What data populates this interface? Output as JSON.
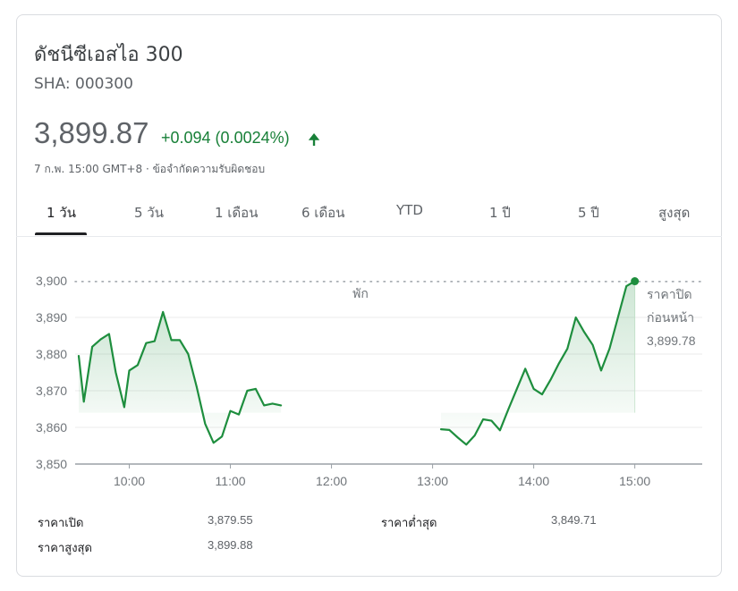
{
  "header": {
    "name": "ดัชนีซีเอสไอ 300",
    "ticker": "SHA: 000300",
    "price": "3,899.87",
    "change": "+0.094 (0.0024%)",
    "timestamp": "7 ก.พ. 15:00 GMT+8 · ข้อจำกัดความรับผิดชอบ"
  },
  "tabs": [
    "1 วัน",
    "5 วัน",
    "1 เดือน",
    "6 เดือน",
    "YTD",
    "1 ปี",
    "5 ปี",
    "สูงสุด"
  ],
  "active_tab": "1 วัน",
  "colors": {
    "line": "#1e8e3e",
    "positive": "#188038",
    "prev_close": "#1e8e3e"
  },
  "chart_data": {
    "type": "line",
    "y_ticks": [
      "3,900",
      "3,890",
      "3,880",
      "3,870",
      "3,860",
      "3,850"
    ],
    "y_tick_values": [
      3900,
      3890,
      3880,
      3870,
      3860,
      3850
    ],
    "x_ticks": [
      "10:00",
      "11:00",
      "12:00",
      "13:00",
      "14:00",
      "15:00"
    ],
    "x_tick_values": [
      "10:00",
      "11:00",
      "12:00",
      "13:00",
      "14:00",
      "15:00"
    ],
    "ylim": [
      3850,
      3900
    ],
    "xlim": [
      "09:30",
      "15:40"
    ],
    "break_label": "พัก",
    "prev_close_label": [
      "ราคาปิด",
      "ก่อนหน้า",
      "3,899.78"
    ],
    "prev_close": 3899.78,
    "morning": {
      "x": [
        "09:30",
        "09:33",
        "09:38",
        "09:43",
        "09:48",
        "09:52",
        "09:57",
        "10:00",
        "10:05",
        "10:10",
        "10:15",
        "10:20",
        "10:25",
        "10:30",
        "10:35",
        "10:40",
        "10:45",
        "10:50",
        "10:55",
        "11:00",
        "11:05",
        "11:10",
        "11:15",
        "11:20",
        "11:25",
        "11:30"
      ],
      "y": [
        3879.5,
        3867,
        3882,
        3884,
        3885.5,
        3875,
        3865.5,
        3875.5,
        3877,
        3883,
        3883.5,
        3891.5,
        3883.8,
        3883.8,
        3880,
        3871,
        3861,
        3855.8,
        3857.5,
        3864.5,
        3863.5,
        3870,
        3870.5,
        3866,
        3866.5,
        3866
      ]
    },
    "afternoon": {
      "x": [
        "13:05",
        "13:10",
        "13:15",
        "13:20",
        "13:25",
        "13:30",
        "13:35",
        "13:40",
        "13:45",
        "13:50",
        "13:55",
        "14:00",
        "14:05",
        "14:10",
        "14:15",
        "14:20",
        "14:25",
        "14:30",
        "14:35",
        "14:40",
        "14:45",
        "14:50",
        "14:55",
        "15:00"
      ],
      "y": [
        3859.5,
        3859.3,
        3857.2,
        3855.3,
        3857.8,
        3862.2,
        3861.8,
        3859.2,
        3865,
        3870.5,
        3876,
        3870.5,
        3869,
        3873,
        3877.5,
        3881.5,
        3890,
        3886,
        3882.5,
        3875.5,
        3881.5,
        3890,
        3898.5,
        3899.87
      ]
    }
  },
  "stats": {
    "open_label": "ราคาเปิด",
    "open_value": "3,879.55",
    "high_label": "ราคาสูงสุด",
    "high_value": "3,899.88",
    "low_label": "ราคาต่ำสุด",
    "low_value": "3,849.71"
  }
}
